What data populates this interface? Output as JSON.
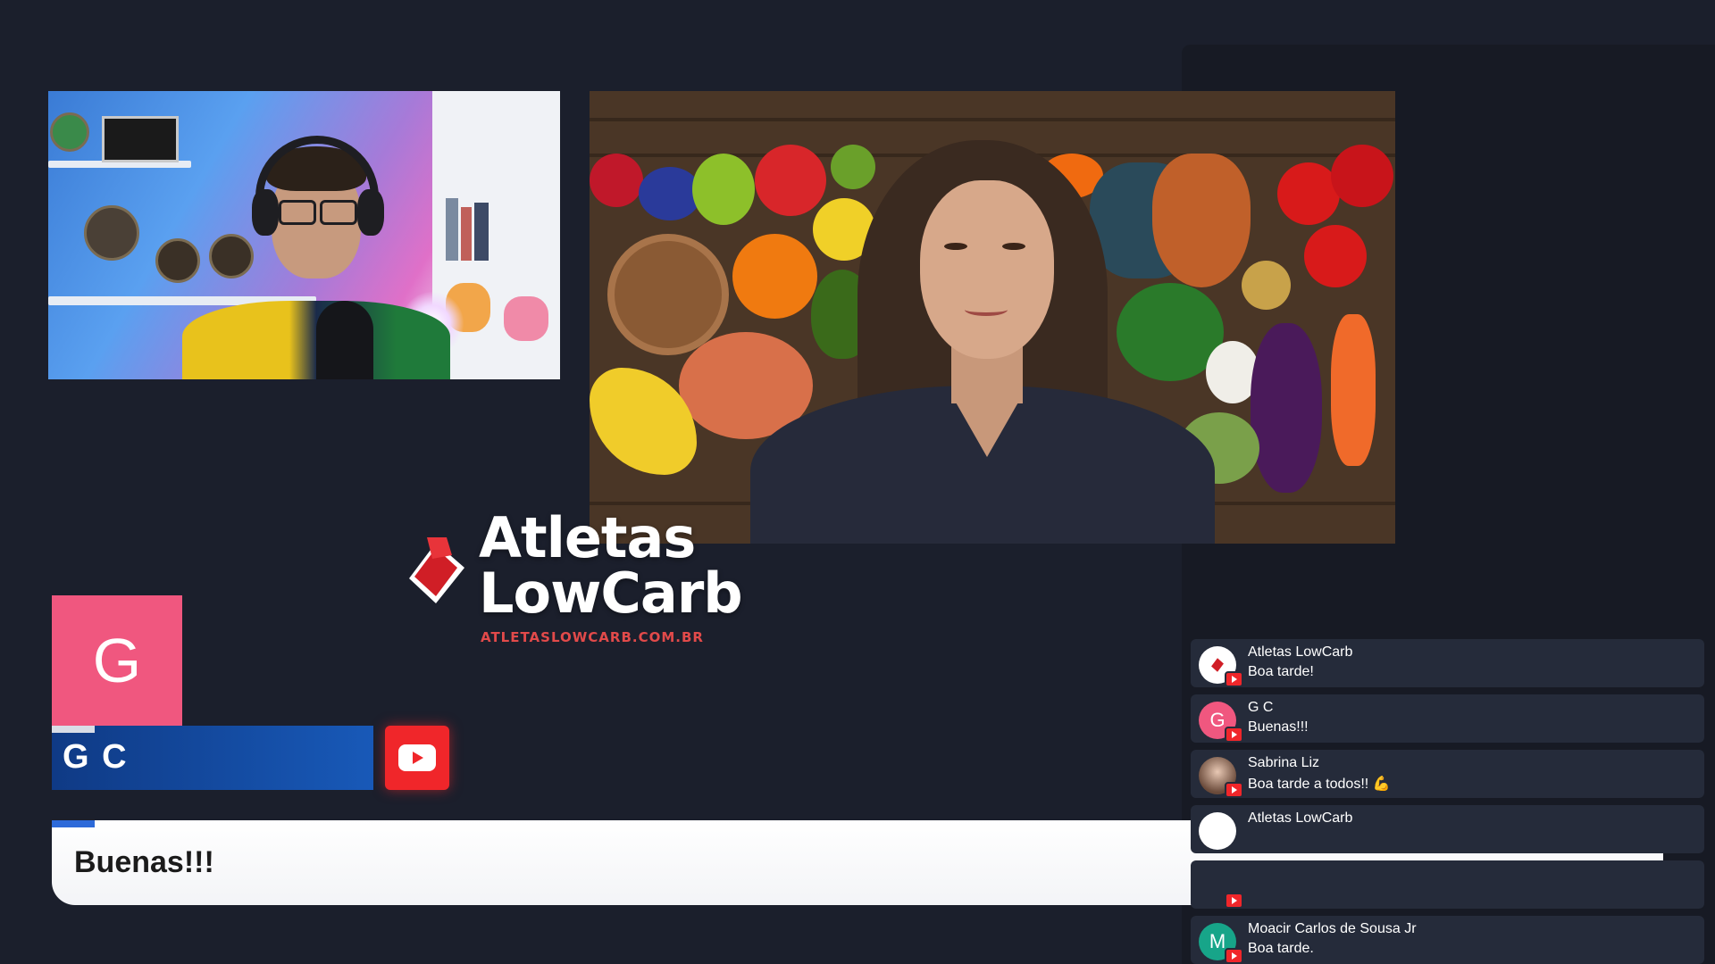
{
  "logo": {
    "line1": "Atletas",
    "line2": "LowCarb",
    "url": "ATLETASLOWCARB.COM.BR"
  },
  "highlight": {
    "avatar_letter": "G",
    "author": "G C",
    "message": "Buenas!!!",
    "platform_icon": "youtube-icon"
  },
  "chat": {
    "messages": [
      {
        "author": "Atletas LowCarb",
        "text": "Boa tarde!",
        "avatar": "logo",
        "avatar_color": "#ffffff"
      },
      {
        "author": "G C",
        "text": "Buenas!!!",
        "avatar": "G",
        "avatar_color": "#f0577f"
      },
      {
        "author": "Sabrina Liz",
        "text": "Boa tarde a todos!! 💪",
        "avatar": "photo",
        "avatar_color": "#d8b9a6"
      },
      {
        "author": "Atletas LowCarb",
        "text": "",
        "avatar": "logo",
        "avatar_color": "#ffffff"
      },
      {
        "author": "",
        "text": "",
        "avatar": "",
        "avatar_color": "#3a3f4e"
      },
      {
        "author": "Moacir Carlos de Sousa Jr",
        "text": "Boa tarde.",
        "avatar": "M",
        "avatar_color": "#17a589"
      }
    ]
  },
  "colors": {
    "background": "#1b1f2c",
    "youtube_red": "#f0262a",
    "name_bar_blue": "#1859b8",
    "accent_pink": "#f0577f"
  }
}
